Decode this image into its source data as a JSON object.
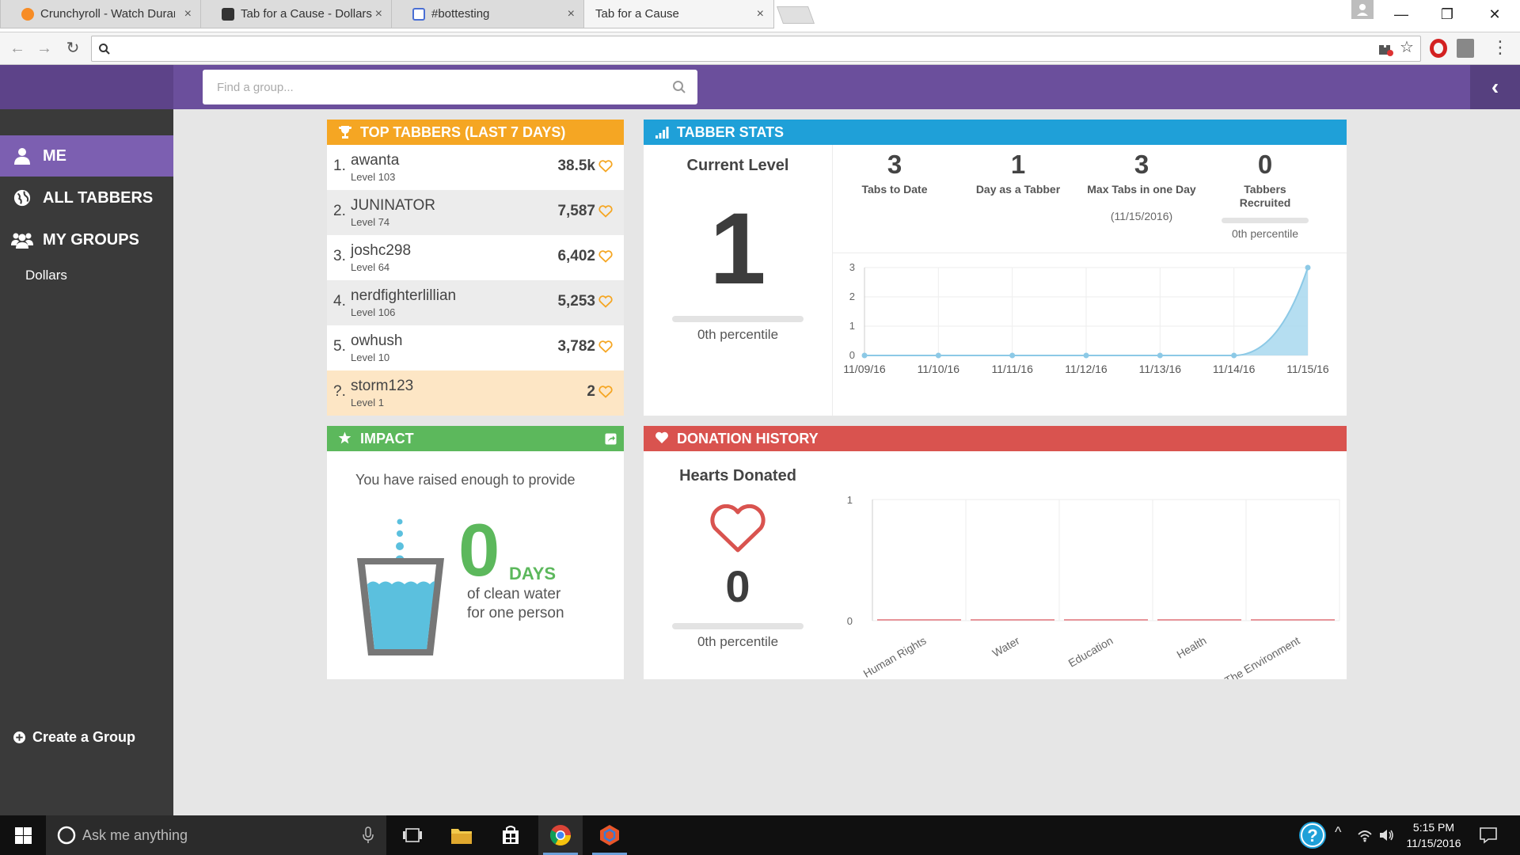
{
  "browser": {
    "tabs": [
      {
        "label": "Crunchyroll - Watch Durarara",
        "close": "×",
        "favicon_color": "#f78c25"
      },
      {
        "label": "Tab for a Cause - Dollars",
        "close": "×",
        "favicon_color": "#333333"
      },
      {
        "label": "#bottesting",
        "close": "×",
        "favicon_color": "#4a6fd4"
      },
      {
        "label": "Tab for a Cause",
        "close": "×",
        "favicon_color": ""
      }
    ],
    "window_controls": {
      "minimize": "—",
      "maximize": "❐",
      "close": "✕"
    },
    "nav": {
      "back": "←",
      "forward": "→",
      "reload": "↻"
    },
    "address_value": ""
  },
  "app": {
    "search_placeholder": "Find a group...",
    "collapse_icon": "‹",
    "accent": "#6b4f9c",
    "sidebar": {
      "items": [
        {
          "label": "ME",
          "icon": "user-icon",
          "active": true
        },
        {
          "label": "ALL TABBERS",
          "icon": "globe-icon",
          "active": false
        },
        {
          "label": "MY GROUPS",
          "icon": "users-icon",
          "active": false
        }
      ],
      "groups": [
        "Dollars"
      ],
      "create_group": "Create a Group"
    },
    "top_tabbers": {
      "title": "TOP TABBERS (LAST 7 DAYS)",
      "color": "#f5a623",
      "rows": [
        {
          "rank": "1.",
          "name": "awanta",
          "level": "Level 103",
          "score": "38.5k"
        },
        {
          "rank": "2.",
          "name": "JUNINATOR",
          "level": "Level 74",
          "score": "7,587"
        },
        {
          "rank": "3.",
          "name": "joshc298",
          "level": "Level 64",
          "score": "6,402"
        },
        {
          "rank": "4.",
          "name": "nerdfighterlillian",
          "level": "Level 106",
          "score": "5,253"
        },
        {
          "rank": "5.",
          "name": "owhush",
          "level": "Level 10",
          "score": "3,782"
        },
        {
          "rank": "?.",
          "name": "storm123",
          "level": "Level 1",
          "score": "2"
        }
      ]
    },
    "tabber_stats": {
      "title": "TABBER STATS",
      "color": "#1fa0d8",
      "current_level_label": "Current Level",
      "current_level": "1",
      "level_percentile": "0th percentile",
      "stats": [
        {
          "value": "3",
          "label": "Tabs to Date",
          "sub": ""
        },
        {
          "value": "1",
          "label": "Day as a Tabber",
          "sub": ""
        },
        {
          "value": "3",
          "label": "Max Tabs in one Day",
          "sub": "(11/15/2016)"
        },
        {
          "value": "0",
          "label": "Tabbers Recruited",
          "sub": "0th percentile"
        }
      ]
    },
    "impact": {
      "title": "IMPACT",
      "color": "#5cb85c",
      "text": "You have raised enough to provide",
      "value": "0",
      "unit": "DAYS",
      "line1": "of clean water",
      "line2": "for one person"
    },
    "donation_history": {
      "title": "DONATION HISTORY",
      "color": "#d9534f",
      "hearts_label": "Hearts Donated",
      "hearts_value": "0",
      "percentile": "0th percentile"
    }
  },
  "chart_data": [
    {
      "type": "area",
      "x": [
        "11/09/16",
        "11/10/16",
        "11/11/16",
        "11/12/16",
        "11/13/16",
        "11/14/16",
        "11/15/16"
      ],
      "values": [
        0,
        0,
        0,
        0,
        0,
        0,
        3
      ],
      "ylim": [
        0,
        3
      ],
      "yticks": [
        "0",
        "1",
        "2",
        "3"
      ],
      "grid": true,
      "color": "#a8d8ef"
    },
    {
      "type": "bar",
      "categories": [
        "Human Rights",
        "Water",
        "Education",
        "Health",
        "The Environment"
      ],
      "values": [
        0,
        0,
        0,
        0,
        0
      ],
      "ylim": [
        0,
        1
      ],
      "yticks": [
        "0",
        "1"
      ],
      "grid": true,
      "color": "#e8959a"
    }
  ],
  "taskbar": {
    "search_placeholder": "Ask me anything",
    "time": "5:15 PM",
    "date": "11/15/2016"
  }
}
